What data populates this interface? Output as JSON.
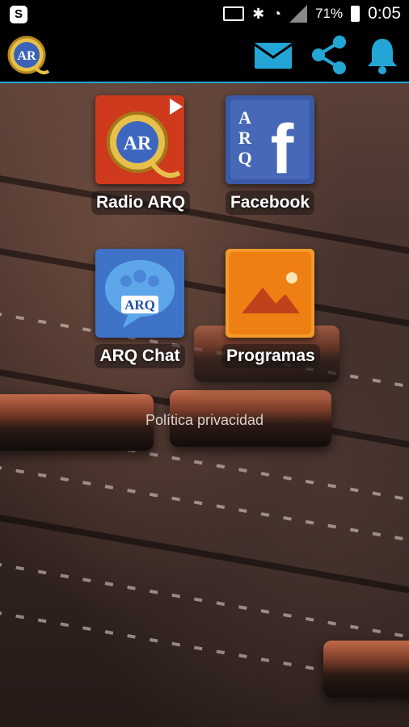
{
  "status_bar": {
    "battery": "71%",
    "time": "0:05"
  },
  "toolbar": {
    "logo_text": "AR",
    "accent_color": "#23a6d5"
  },
  "tiles": [
    {
      "label": "Radio ARQ",
      "icon": "radio-arq-icon",
      "icon_text": "AR"
    },
    {
      "label": "Facebook",
      "icon": "facebook-arq-icon",
      "icon_text": "ARQ"
    },
    {
      "label": "ARQ Chat",
      "icon": "arq-chat-icon",
      "icon_text": "ARQ"
    },
    {
      "label": "Programas",
      "icon": "gallery-icon"
    }
  ],
  "privacy_link": "Política privacidad"
}
